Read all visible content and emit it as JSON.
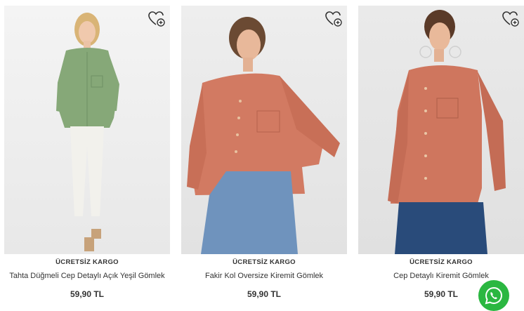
{
  "products": [
    {
      "badge": "ÜCRETSİZ KARGO",
      "title": "Tahta Düğmeli Cep Detaylı Açık Yeşil Gömlek",
      "price": "59,90 TL",
      "shirt_color": "#86a878",
      "pants_color": "#f2f1ec"
    },
    {
      "badge": "ÜCRETSİZ KARGO",
      "title": "Fakir Kol Oversize Kiremit Gömlek",
      "price": "59,90 TL",
      "shirt_color": "#d27a62",
      "pants_color": "#6f93bd"
    },
    {
      "badge": "ÜCRETSİZ KARGO",
      "title": "Cep Detaylı Kiremit Gömlek",
      "price": "59,90 TL",
      "shirt_color": "#cf765e",
      "pants_color": "#294b7a"
    }
  ],
  "icons": {
    "favorite": "heart-plus-icon",
    "whatsapp": "whatsapp-icon"
  },
  "colors": {
    "whatsapp_green": "#2bb741",
    "text": "#333333"
  }
}
